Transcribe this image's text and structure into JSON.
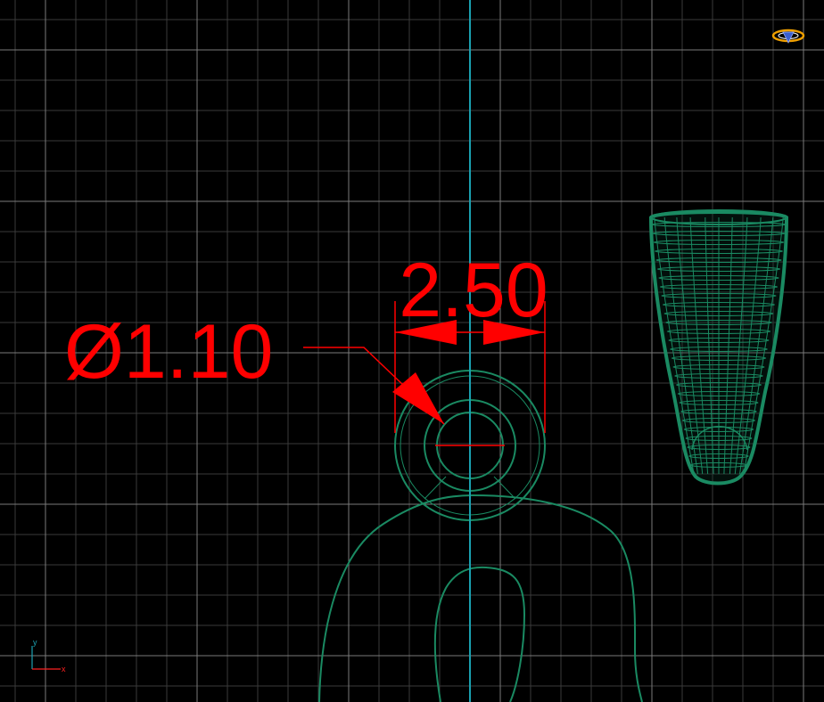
{
  "viewport": {
    "background": "#000000",
    "grid_minor_color": "#3a3a3a",
    "grid_major_color": "#7a7a7a",
    "centerline_color": "#1aa0b0",
    "geometry_color": "#1a8a62",
    "dimension_color": "#ff0000"
  },
  "dimensions": {
    "linear": {
      "value": "2.50"
    },
    "diameter": {
      "value": "Ø1.10"
    }
  },
  "ucs": {
    "x_label": "x",
    "y_label": "y"
  },
  "nav_gizmo": {
    "icon": "viewcube-gizmo-icon",
    "color": "#f0a000"
  }
}
